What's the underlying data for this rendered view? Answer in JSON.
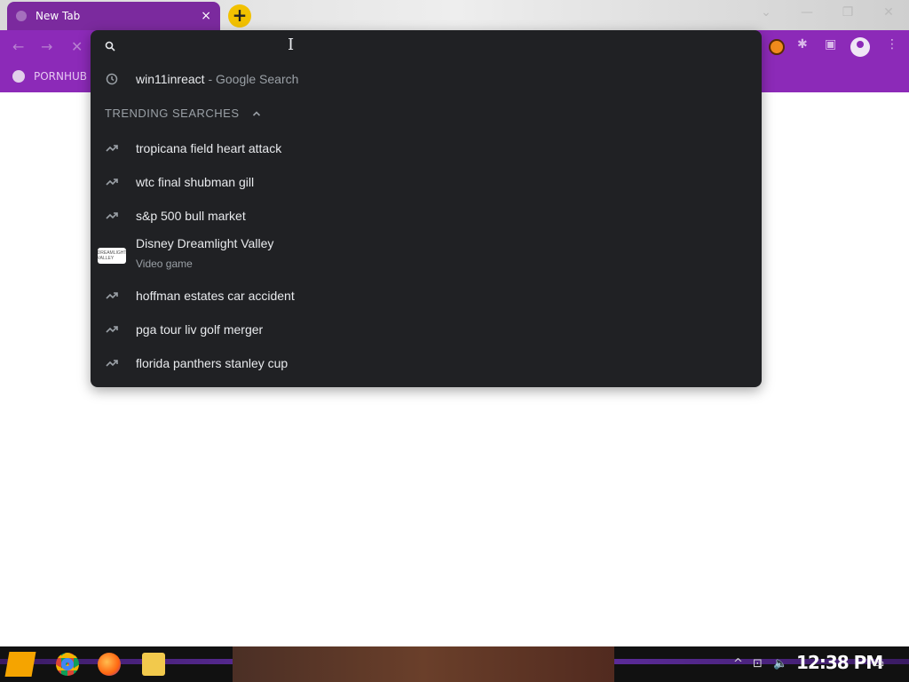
{
  "window": {
    "tab_title": "New Tab",
    "tab_close": "×",
    "new_tab_label": "+",
    "controls": {
      "dropdown": "⌄",
      "minimize": "—",
      "restore": "❐",
      "close": "✕"
    }
  },
  "toolbar": {
    "back": "←",
    "forward": "→",
    "stop": "✕",
    "extensions": "✱",
    "sidebar": "▣",
    "menu": "⋮"
  },
  "bookmarks": {
    "items": [
      {
        "label": "PORNHUB"
      }
    ]
  },
  "omnibox": {
    "value": "",
    "cursor": "I"
  },
  "suggestions": {
    "history": {
      "query": "win11inreact",
      "suffix": " - Google Search"
    },
    "section_title": "TRENDING SEARCHES",
    "trending": [
      {
        "text": "tropicana field heart attack"
      },
      {
        "text": "wtc final shubman gill"
      },
      {
        "text": "s&p 500 bull market"
      },
      {
        "text": "Disney Dreamlight Valley",
        "subtitle": "Video game",
        "thumb": "DREAMLIGHT VALLEY"
      },
      {
        "text": "hoffman estates car accident"
      },
      {
        "text": "pga tour liv golf merger"
      },
      {
        "text": "florida panthers stanley cup"
      }
    ]
  },
  "taskbar": {
    "clock": "12:38 PM",
    "tray": {
      "chevron": "^",
      "network": "⊡",
      "volume": "🔈",
      "notifications": "▭"
    }
  },
  "colors": {
    "accent": "#8c2ab8",
    "dropdown_bg": "#202124",
    "text_primary": "#e8eaed",
    "text_secondary": "#9aa0a6",
    "new_tab_yellow": "#f2c100"
  }
}
